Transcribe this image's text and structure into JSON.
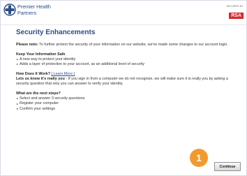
{
  "brand": {
    "name_line1": "Premier Health",
    "name_line2": "Partners"
  },
  "secured": {
    "label": "SECURED BY",
    "logo": "RSA"
  },
  "page": {
    "title": "Security Enhancements"
  },
  "intro": {
    "lead": "Please note:",
    "text": "To further protect the security of your information on our website, we've made some changes to our account login."
  },
  "keep_safe": {
    "heading": "Keep Your Information Safe",
    "items": [
      "A new way to protect your identity",
      "Adds a layer of protection to your account, as an additional level of security"
    ]
  },
  "how": {
    "heading": "How Does It Work?",
    "link": "[ Learn More ]",
    "lead": "Lets us know it's really you",
    "text": " - If you sign in from a computer we do not recognize, we will make sure it is really you by asking a security question that only you can answer to verify your identity."
  },
  "next": {
    "heading": "What are the next steps?",
    "items": [
      "Select and answer 3 security questions",
      "Register your computer",
      "Confirm your settings"
    ]
  },
  "callout": {
    "number": "1"
  },
  "continue_label": "Continue"
}
